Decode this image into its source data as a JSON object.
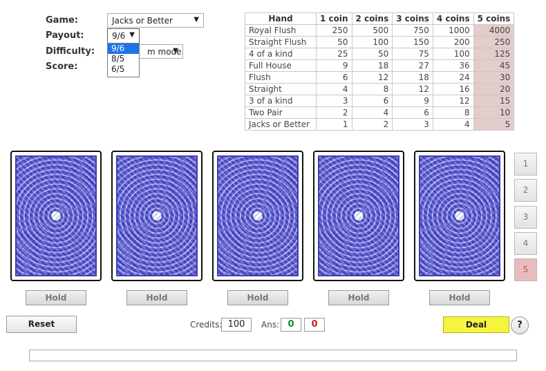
{
  "settings": {
    "game_label": "Game:",
    "game_value": "Jacks or Better",
    "payout_label": "Payout:",
    "payout_value": "9/6",
    "difficulty_label": "Difficulty:",
    "difficulty_value": "m mode",
    "score_label": "Score:",
    "payout_options": [
      "9/6",
      "8/5",
      "6/5"
    ]
  },
  "paytable": {
    "headers": [
      "Hand",
      "1 coin",
      "2 coins",
      "3 coins",
      "4 coins",
      "5 coins"
    ],
    "rows": [
      {
        "hand": "Royal Flush",
        "v": [
          "250",
          "500",
          "750",
          "1000",
          "4000"
        ]
      },
      {
        "hand": "Straight Flush",
        "v": [
          "50",
          "100",
          "150",
          "200",
          "250"
        ]
      },
      {
        "hand": "4 of a kind",
        "v": [
          "25",
          "50",
          "75",
          "100",
          "125"
        ]
      },
      {
        "hand": "Full House",
        "v": [
          "9",
          "18",
          "27",
          "36",
          "45"
        ]
      },
      {
        "hand": "Flush",
        "v": [
          "6",
          "12",
          "18",
          "24",
          "30"
        ]
      },
      {
        "hand": "Straight",
        "v": [
          "4",
          "8",
          "12",
          "16",
          "20"
        ]
      },
      {
        "hand": "3 of a kind",
        "v": [
          "3",
          "6",
          "9",
          "12",
          "15"
        ]
      },
      {
        "hand": "Two Pair",
        "v": [
          "2",
          "4",
          "6",
          "8",
          "10"
        ]
      },
      {
        "hand": "Jacks or Better",
        "v": [
          "1",
          "2",
          "3",
          "4",
          "5"
        ]
      }
    ]
  },
  "hold_label": "Hold",
  "coins": [
    "1",
    "2",
    "3",
    "4",
    "5"
  ],
  "controls": {
    "reset_label": "Reset",
    "credits_label": "Credits:",
    "credits_value": "100",
    "ans_label": "Ans:",
    "ans_correct": "0",
    "ans_wrong": "0",
    "deal_label": "Deal",
    "help_label": "?"
  },
  "colors": {
    "deal_bg": "#f5f540",
    "selected_coin": "#e8bcbc",
    "five_coin_column": "#e3cccc",
    "ans_correct": "#1a8a1a",
    "ans_wrong": "#d02020"
  }
}
